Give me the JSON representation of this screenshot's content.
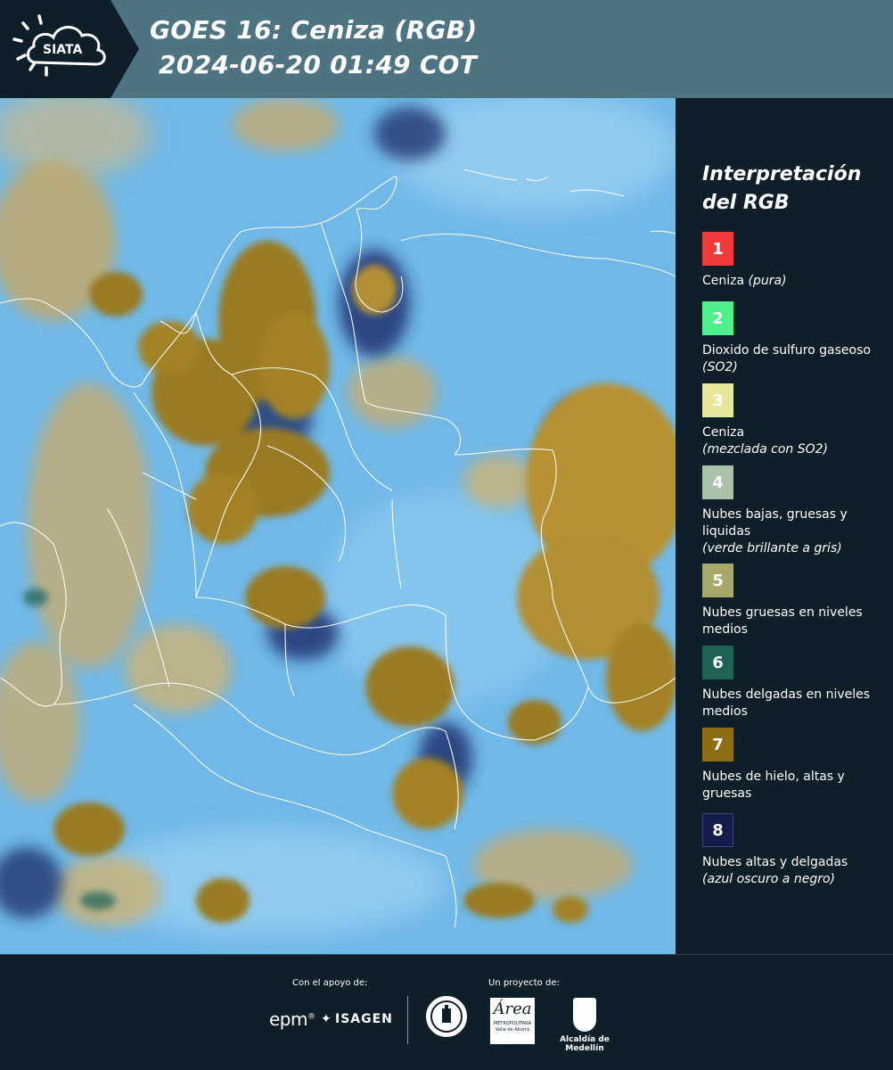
{
  "header": {
    "logo_text": "SIATA",
    "title": "GOES 16: Ceniza (RGB)",
    "subtitle": "2024-06-20 01:49 COT",
    "background_color": "#4e7482"
  },
  "map": {
    "product": "GOES 16 Ash RGB",
    "palette": {
      "sky_blue": "#6fb8e8",
      "ice_cloud": "#9a7a22",
      "thin_high_cloud": "#1b2c6a",
      "mid_cloud": "#c2a96a"
    },
    "border_color": "#ffffff"
  },
  "legend": {
    "title": "Interpretación del RGB",
    "items": [
      {
        "number": "1",
        "color": "#ef3b3b",
        "label": "Ceniza",
        "note": "(pura)"
      },
      {
        "number": "2",
        "color": "#4ff08c",
        "label": "Dioxido de sulfuro gaseoso",
        "note": "(SO2)"
      },
      {
        "number": "3",
        "color": "#e8e69a",
        "label": "Ceniza",
        "note": "(mezclada con SO2)"
      },
      {
        "number": "4",
        "color": "#a9c2a8",
        "label": "Nubes bajas, gruesas y liquidas",
        "note": "(verde brillante a gris)"
      },
      {
        "number": "5",
        "color": "#a6a86a",
        "label": "Nubes gruesas en niveles medios",
        "note": ""
      },
      {
        "number": "6",
        "color": "#1f6256",
        "label": "Nubes delgadas en niveles medios",
        "note": ""
      },
      {
        "number": "7",
        "color": "#8c6d12",
        "label": "Nubes de hielo, altas y gruesas",
        "note": ""
      },
      {
        "number": "8",
        "color": "#141a4c",
        "label": "Nubes altas y delgadas",
        "note": "(azul oscuro a negro)"
      }
    ]
  },
  "footer": {
    "support_label": "Con el apoyo de:",
    "project_label": "Un proyecto de:",
    "epm": "epm",
    "epm_mark": "®",
    "isagen": "ISAGEN",
    "area_big": "Área",
    "area_small": "METROPOLITANA Valle de Aburrá",
    "alcaldia": "Alcaldía de Medellín"
  }
}
